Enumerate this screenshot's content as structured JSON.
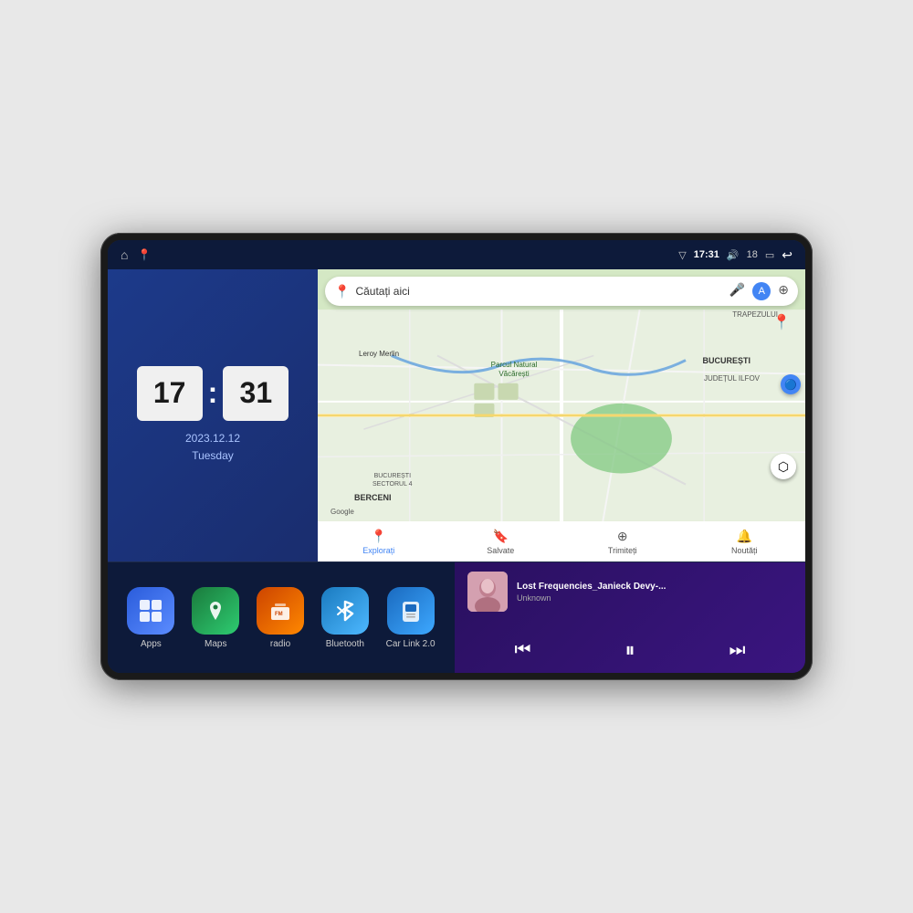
{
  "device": {
    "statusBar": {
      "time": "17:31",
      "signal": "▽",
      "volume_icon": "🔊",
      "battery": "18",
      "battery_icon": "🔋",
      "back_icon": "↩"
    },
    "homeIcon": "⌂",
    "mapsStatusIcon": "📍",
    "clock": {
      "hours": "17",
      "minutes": "31",
      "date": "2023.12.12",
      "day": "Tuesday"
    },
    "map": {
      "searchPlaceholder": "Căutați aici",
      "navItems": [
        {
          "label": "Explorați",
          "icon": "📍",
          "active": true
        },
        {
          "label": "Salvate",
          "icon": "🔖",
          "active": false
        },
        {
          "label": "Trimiteți",
          "icon": "⊕",
          "active": false
        },
        {
          "label": "Noutăți",
          "icon": "🔔",
          "active": false
        }
      ],
      "labels": [
        "BUCUREȘTI",
        "JUDEȚUL ILFOV",
        "BERCENI",
        "TRAPEZULUI",
        "Parcul Natural Văcărești",
        "Leroy Merlin",
        "BUCUREȘTI\nSECTORUL 4",
        "Google"
      ]
    },
    "apps": [
      {
        "id": "apps",
        "label": "Apps",
        "iconClass": "icon-apps",
        "iconSymbol": "⊞"
      },
      {
        "id": "maps",
        "label": "Maps",
        "iconClass": "icon-maps",
        "iconSymbol": "📍"
      },
      {
        "id": "radio",
        "label": "radio",
        "iconClass": "icon-radio",
        "iconSymbol": "📻"
      },
      {
        "id": "bluetooth",
        "label": "Bluetooth",
        "iconClass": "icon-bluetooth",
        "iconSymbol": "⚡"
      },
      {
        "id": "carlink",
        "label": "Car Link 2.0",
        "iconClass": "icon-carlink",
        "iconSymbol": "📱"
      }
    ],
    "music": {
      "title": "Lost Frequencies_Janieck Devy-...",
      "artist": "Unknown",
      "albumArtEmoji": "👩"
    }
  }
}
